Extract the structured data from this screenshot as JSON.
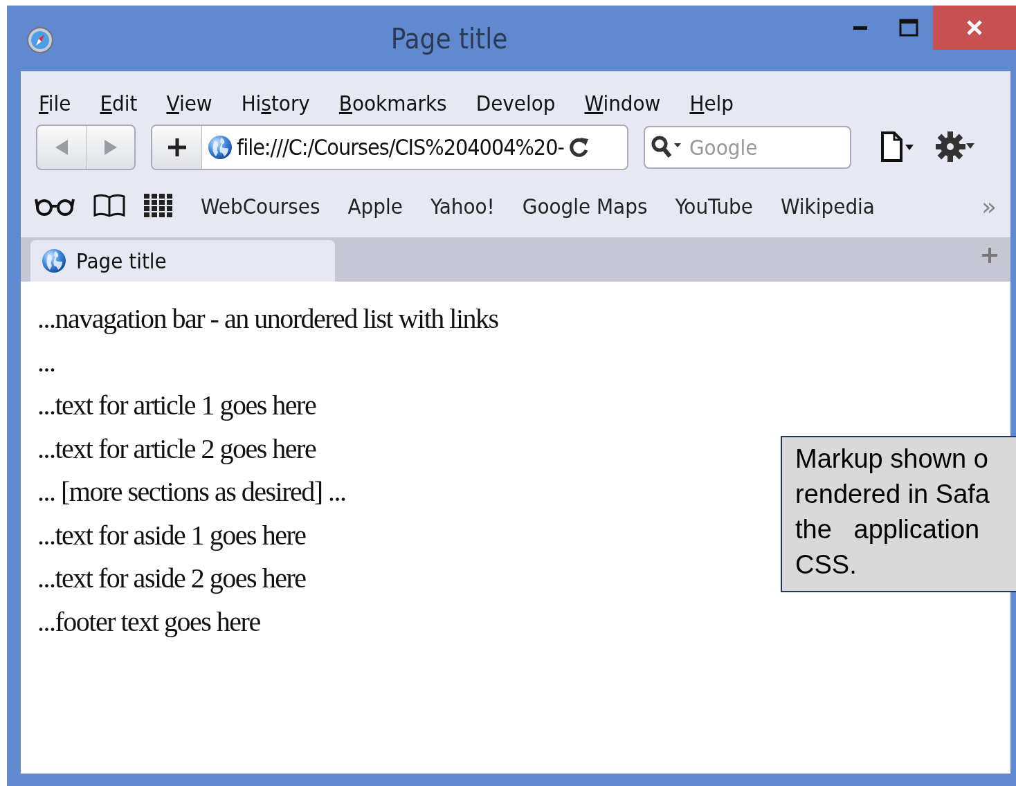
{
  "window": {
    "title": "Page title"
  },
  "menu": [
    {
      "key": "F",
      "after": "ile"
    },
    {
      "key": "E",
      "after": "dit"
    },
    {
      "key": "V",
      "after": "iew"
    },
    {
      "before": "Hi",
      "key": "s",
      "after": "tory"
    },
    {
      "key": "B",
      "after": "ookmarks"
    },
    {
      "before": "Develop"
    },
    {
      "key": "W",
      "after": "indow"
    },
    {
      "key": "H",
      "after": "elp"
    }
  ],
  "toolbar": {
    "address": "file:///C:/Courses/CIS%204004%20-",
    "search": {
      "placeholder": "Google"
    }
  },
  "bookmarks": [
    "WebCourses",
    "Apple",
    "Yahoo!",
    "Google Maps",
    "YouTube",
    "Wikipedia"
  ],
  "bookmarks_more": "»",
  "tabs": [
    {
      "label": "Page title",
      "selected": true
    }
  ],
  "content": [
    "...navagation bar - an unordered list with links",
    "...",
    "...text for article 1 goes here",
    "...text for article 2 goes here",
    "... [more sections as desired] ...",
    "...text for aside 1 goes here",
    "...text for aside 2 goes here",
    "...footer text goes here"
  ],
  "callout": {
    "lines": [
      "Markup shown o",
      "rendered in Safa",
      "the   application",
      "CSS."
    ]
  }
}
